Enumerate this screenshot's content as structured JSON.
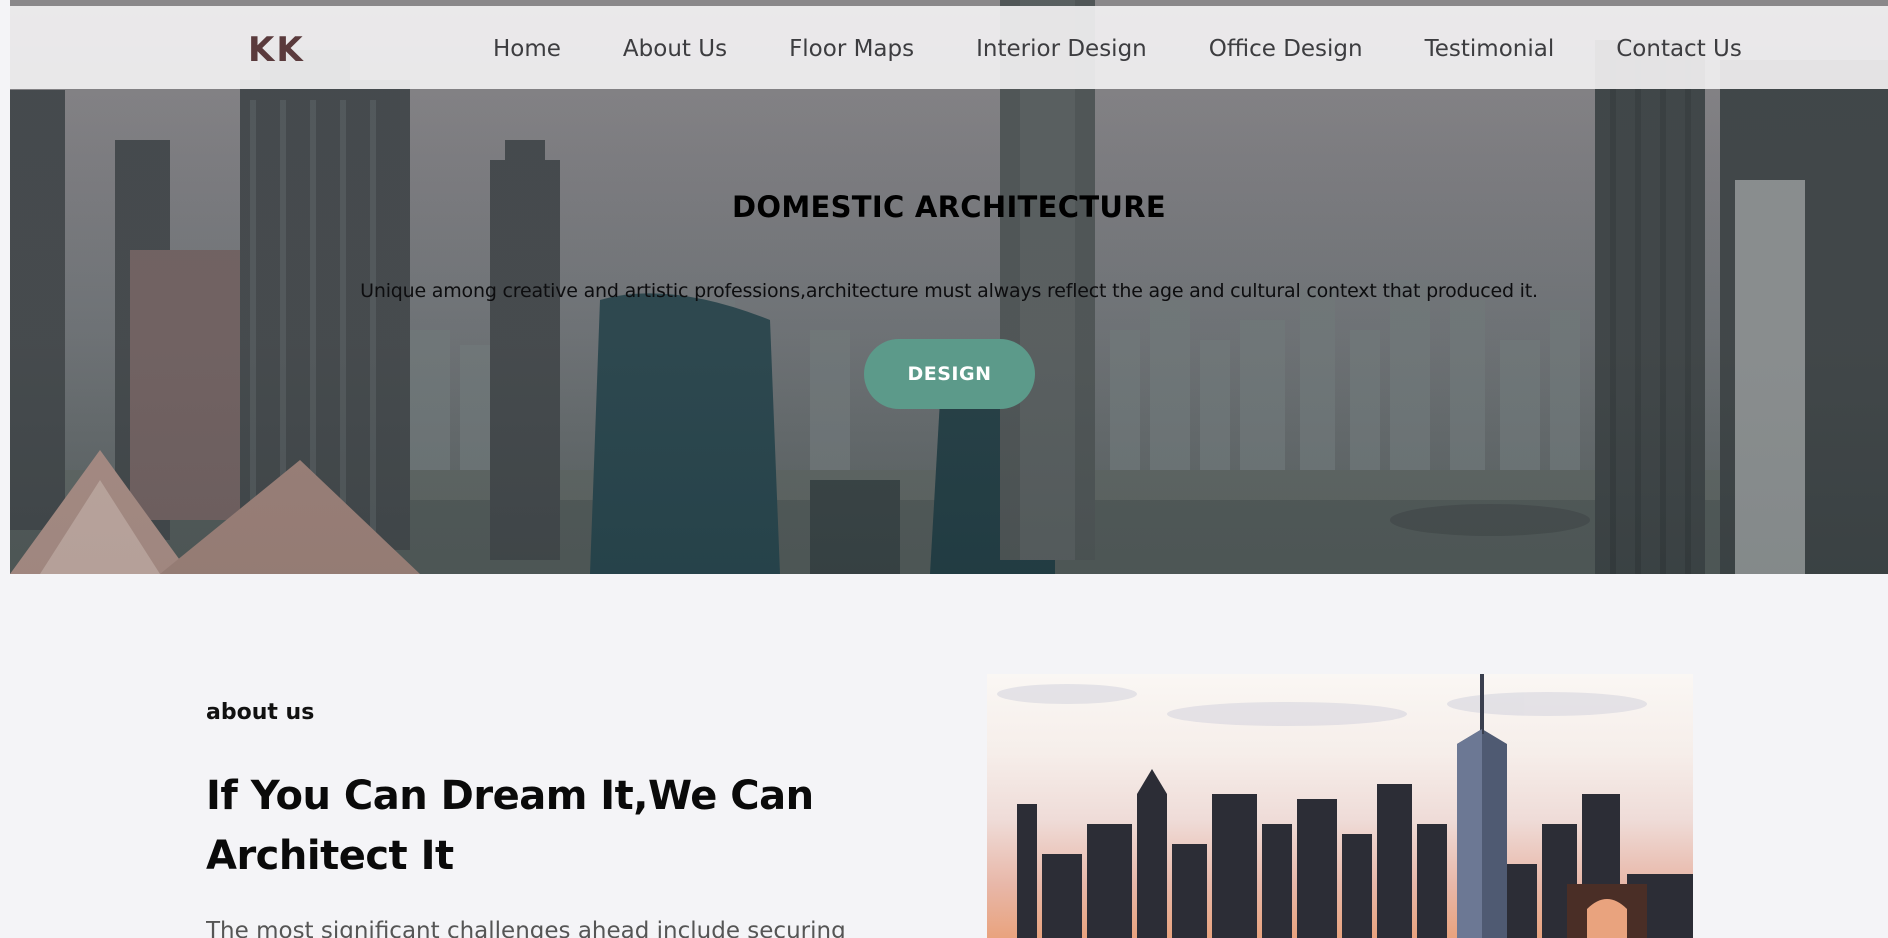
{
  "nav": {
    "logo": "KK",
    "links": [
      "Home",
      "About Us",
      "Floor Maps",
      "Interior Design",
      "Office Design",
      "Testimonial",
      "Contact Us"
    ]
  },
  "hero": {
    "title": "DOMESTIC ARCHITECTURE",
    "subtitle": "Unique among creative and artistic professions,architecture must always reflect the age and cultural context that produced it.",
    "button_label": "DESIGN"
  },
  "about": {
    "eyebrow": "about us",
    "title": "If You Can Dream It,We Can Architect It",
    "body": "The most significant challenges ahead include securing"
  },
  "colors": {
    "logo": "#5a3a3c",
    "button": "#5c9a8a",
    "page_background": "#f4f4f7"
  },
  "images": {
    "hero_background": "city-skyline-photo",
    "about_image": "city-skyline-sunset-photo"
  }
}
